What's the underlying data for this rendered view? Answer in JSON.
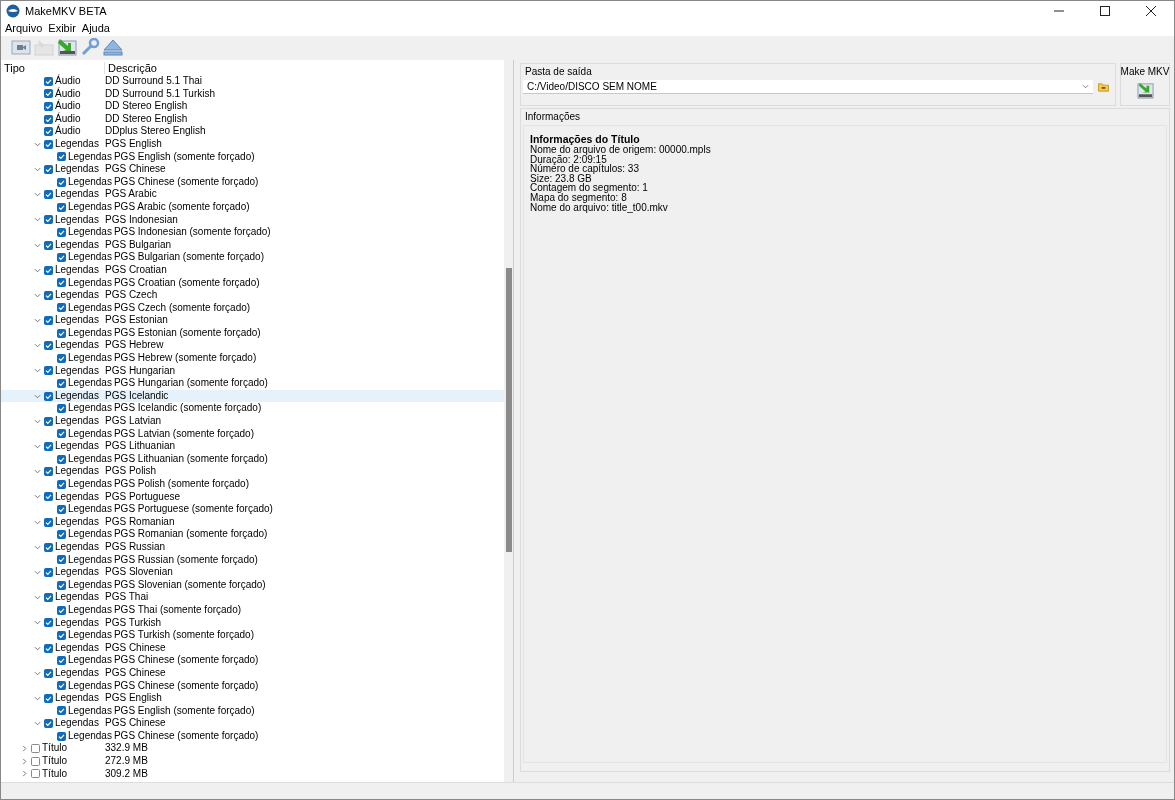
{
  "window": {
    "title": "MakeMKV BETA"
  },
  "menu": [
    {
      "label": "Arquivo"
    },
    {
      "label": "Exibir"
    },
    {
      "label": "Ajuda"
    }
  ],
  "toolbar": [
    {
      "kind": "video",
      "disabled": false
    },
    {
      "kind": "open",
      "disabled": true
    },
    {
      "kind": "backup",
      "disabled": false
    },
    {
      "kind": "settings",
      "disabled": false
    },
    {
      "kind": "eject",
      "disabled": false
    }
  ],
  "tree": {
    "columns": [
      "Tipo",
      "Descrição"
    ],
    "items": [
      {
        "type": "Áudio",
        "description": "DD Surround 5.1 Thai",
        "checked": true,
        "selected": false
      },
      {
        "type": "Áudio",
        "description": "DD Surround 5.1 Turkish",
        "checked": true,
        "selected": false
      },
      {
        "type": "Áudio",
        "description": "DD Stereo English",
        "checked": true,
        "selected": false
      },
      {
        "type": "Áudio",
        "description": "DD Stereo English",
        "checked": true,
        "selected": false
      },
      {
        "type": "Áudio",
        "description": "DDplus Stereo English",
        "checked": true,
        "selected": false
      },
      {
        "type": "Legendas",
        "description": "PGS English",
        "checked": true,
        "selected": false,
        "expanded": true,
        "children": [
          {
            "type": "Legendas",
            "description": "PGS English (somente forçado)",
            "checked": true,
            "selected": false
          }
        ]
      },
      {
        "type": "Legendas",
        "description": "PGS Chinese",
        "checked": true,
        "selected": false,
        "expanded": true,
        "children": [
          {
            "type": "Legendas",
            "description": "PGS Chinese (somente forçado)",
            "checked": true,
            "selected": false
          }
        ]
      },
      {
        "type": "Legendas",
        "description": "PGS Arabic",
        "checked": true,
        "selected": false,
        "expanded": true,
        "children": [
          {
            "type": "Legendas",
            "description": "PGS Arabic (somente forçado)",
            "checked": true,
            "selected": false
          }
        ]
      },
      {
        "type": "Legendas",
        "description": "PGS Indonesian",
        "checked": true,
        "selected": false,
        "expanded": true,
        "children": [
          {
            "type": "Legendas",
            "description": "PGS Indonesian (somente forçado)",
            "checked": true,
            "selected": false
          }
        ]
      },
      {
        "type": "Legendas",
        "description": "PGS Bulgarian",
        "checked": true,
        "selected": false,
        "expanded": true,
        "children": [
          {
            "type": "Legendas",
            "description": "PGS Bulgarian (somente forçado)",
            "checked": true,
            "selected": false
          }
        ]
      },
      {
        "type": "Legendas",
        "description": "PGS Croatian",
        "checked": true,
        "selected": false,
        "expanded": true,
        "children": [
          {
            "type": "Legendas",
            "description": "PGS Croatian (somente forçado)",
            "checked": true,
            "selected": false
          }
        ]
      },
      {
        "type": "Legendas",
        "description": "PGS Czech",
        "checked": true,
        "selected": false,
        "expanded": true,
        "children": [
          {
            "type": "Legendas",
            "description": "PGS Czech (somente forçado)",
            "checked": true,
            "selected": false
          }
        ]
      },
      {
        "type": "Legendas",
        "description": "PGS Estonian",
        "checked": true,
        "selected": false,
        "expanded": true,
        "children": [
          {
            "type": "Legendas",
            "description": "PGS Estonian (somente forçado)",
            "checked": true,
            "selected": false
          }
        ]
      },
      {
        "type": "Legendas",
        "description": "PGS Hebrew",
        "checked": true,
        "selected": false,
        "expanded": true,
        "children": [
          {
            "type": "Legendas",
            "description": "PGS Hebrew (somente forçado)",
            "checked": true,
            "selected": false
          }
        ]
      },
      {
        "type": "Legendas",
        "description": "PGS Hungarian",
        "checked": true,
        "selected": false,
        "expanded": true,
        "children": [
          {
            "type": "Legendas",
            "description": "PGS Hungarian (somente forçado)",
            "checked": true,
            "selected": false
          }
        ]
      },
      {
        "type": "Legendas",
        "description": "PGS Icelandic",
        "checked": true,
        "selected": true,
        "expanded": true,
        "children": [
          {
            "type": "Legendas",
            "description": "PGS Icelandic (somente forçado)",
            "checked": true,
            "selected": false
          }
        ]
      },
      {
        "type": "Legendas",
        "description": "PGS Latvian",
        "checked": true,
        "selected": false,
        "expanded": true,
        "children": [
          {
            "type": "Legendas",
            "description": "PGS Latvian (somente forçado)",
            "checked": true,
            "selected": false
          }
        ]
      },
      {
        "type": "Legendas",
        "description": "PGS Lithuanian",
        "checked": true,
        "selected": false,
        "expanded": true,
        "children": [
          {
            "type": "Legendas",
            "description": "PGS Lithuanian (somente forçado)",
            "checked": true,
            "selected": false
          }
        ]
      },
      {
        "type": "Legendas",
        "description": "PGS Polish",
        "checked": true,
        "selected": false,
        "expanded": true,
        "children": [
          {
            "type": "Legendas",
            "description": "PGS Polish (somente forçado)",
            "checked": true,
            "selected": false
          }
        ]
      },
      {
        "type": "Legendas",
        "description": "PGS Portuguese",
        "checked": true,
        "selected": false,
        "expanded": true,
        "children": [
          {
            "type": "Legendas",
            "description": "PGS Portuguese (somente forçado)",
            "checked": true,
            "selected": false
          }
        ]
      },
      {
        "type": "Legendas",
        "description": "PGS Romanian",
        "checked": true,
        "selected": false,
        "expanded": true,
        "children": [
          {
            "type": "Legendas",
            "description": "PGS Romanian (somente forçado)",
            "checked": true,
            "selected": false
          }
        ]
      },
      {
        "type": "Legendas",
        "description": "PGS Russian",
        "checked": true,
        "selected": false,
        "expanded": true,
        "children": [
          {
            "type": "Legendas",
            "description": "PGS Russian (somente forçado)",
            "checked": true,
            "selected": false
          }
        ]
      },
      {
        "type": "Legendas",
        "description": "PGS Slovenian",
        "checked": true,
        "selected": false,
        "expanded": true,
        "children": [
          {
            "type": "Legendas",
            "description": "PGS Slovenian (somente forçado)",
            "checked": true,
            "selected": false
          }
        ]
      },
      {
        "type": "Legendas",
        "description": "PGS Thai",
        "checked": true,
        "selected": false,
        "expanded": true,
        "children": [
          {
            "type": "Legendas",
            "description": "PGS Thai (somente forçado)",
            "checked": true,
            "selected": false
          }
        ]
      },
      {
        "type": "Legendas",
        "description": "PGS Turkish",
        "checked": true,
        "selected": false,
        "expanded": true,
        "children": [
          {
            "type": "Legendas",
            "description": "PGS Turkish (somente forçado)",
            "checked": true,
            "selected": false
          }
        ]
      },
      {
        "type": "Legendas",
        "description": "PGS Chinese",
        "checked": true,
        "selected": false,
        "expanded": true,
        "children": [
          {
            "type": "Legendas",
            "description": "PGS Chinese (somente forçado)",
            "checked": true,
            "selected": false
          }
        ]
      },
      {
        "type": "Legendas",
        "description": "PGS Chinese",
        "checked": true,
        "selected": false,
        "expanded": true,
        "children": [
          {
            "type": "Legendas",
            "description": "PGS Chinese (somente forçado)",
            "checked": true,
            "selected": false
          }
        ]
      },
      {
        "type": "Legendas",
        "description": "PGS English",
        "checked": true,
        "selected": false,
        "expanded": true,
        "children": [
          {
            "type": "Legendas",
            "description": "PGS English (somente forçado)",
            "checked": true,
            "selected": false
          }
        ]
      },
      {
        "type": "Legendas",
        "description": "PGS Chinese",
        "checked": true,
        "selected": false,
        "expanded": true,
        "children": [
          {
            "type": "Legendas",
            "description": "PGS Chinese (somente forçado)",
            "checked": true,
            "selected": false
          }
        ]
      },
      {
        "kind": "title",
        "type": "Título",
        "description": "332.9 MB",
        "checked": false,
        "selected": false,
        "expanded": false
      },
      {
        "kind": "title",
        "type": "Título",
        "description": "272.9 MB",
        "checked": false,
        "selected": false,
        "expanded": false
      },
      {
        "kind": "title",
        "type": "Título",
        "description": "309.2 MB",
        "checked": false,
        "selected": false,
        "expanded": false
      }
    ]
  },
  "output": {
    "label": "Pasta de saída",
    "value": "C:/Video/DISCO SEM NOME"
  },
  "make_mkv": {
    "label": "Make MKV"
  },
  "info": {
    "label": "Informações",
    "heading": "Informações do Título",
    "lines": [
      "Nome do arquivo de origem: 00000.mpls",
      "Duração: 2:09:15",
      "Número de capítulos: 33",
      "Size: 23.8 GB",
      "Contagem do segmento: 1",
      "Mapa do segmento: 8",
      "Nome do arquivo: title_t00.mkv"
    ]
  }
}
